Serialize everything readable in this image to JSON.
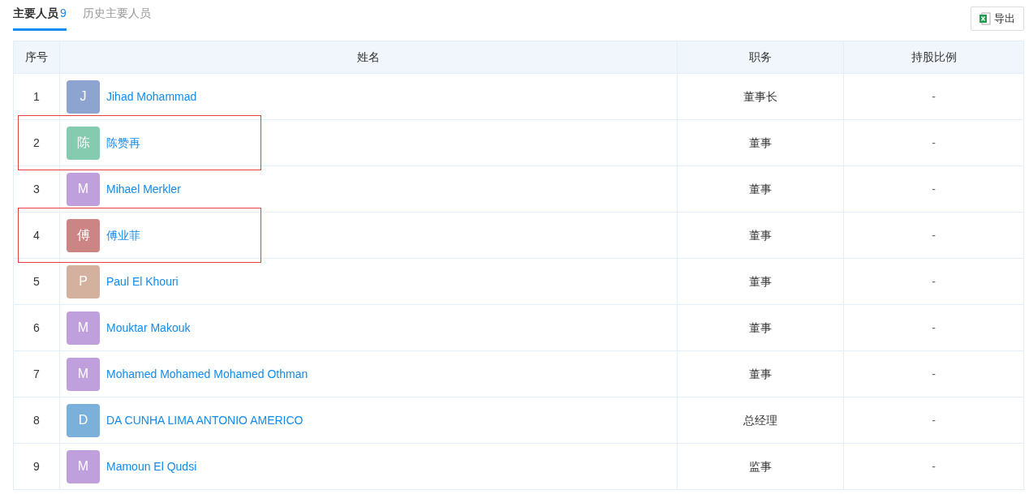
{
  "tabs": [
    {
      "label": "主要人员",
      "count": "9",
      "selected": true
    },
    {
      "label": "历史主要人员",
      "selected": false
    }
  ],
  "export_button": {
    "label": "导出"
  },
  "table": {
    "columns": [
      "序号",
      "姓名",
      "职务",
      "持股比例"
    ],
    "rows": [
      {
        "index": "1",
        "avatar": "J",
        "color": "#8da4d0",
        "name": "Jihad Mohammad",
        "position": "董事长",
        "share": "-",
        "highlighted": false
      },
      {
        "index": "2",
        "avatar": "陈",
        "color": "#85cbaf",
        "name": "陈赞再",
        "position": "董事",
        "share": "-",
        "highlighted": true
      },
      {
        "index": "3",
        "avatar": "M",
        "color": "#bfa0dc",
        "name": "Mihael Merkler",
        "position": "董事",
        "share": "-",
        "highlighted": false
      },
      {
        "index": "4",
        "avatar": "傅",
        "color": "#cc8484",
        "name": "傅业菲",
        "position": "董事",
        "share": "-",
        "highlighted": true
      },
      {
        "index": "5",
        "avatar": "P",
        "color": "#d4b09e",
        "name": "Paul El Khouri",
        "position": "董事",
        "share": "-",
        "highlighted": false
      },
      {
        "index": "6",
        "avatar": "M",
        "color": "#bfa0dc",
        "name": "Mouktar Makouk",
        "position": "董事",
        "share": "-",
        "highlighted": false
      },
      {
        "index": "7",
        "avatar": "M",
        "color": "#bfa0dc",
        "name": "Mohamed Mohamed Mohamed Othman",
        "position": "董事",
        "share": "-",
        "highlighted": false
      },
      {
        "index": "8",
        "avatar": "D",
        "color": "#7ab0d9",
        "name": "DA CUNHA LIMA ANTONIO AMERICO",
        "position": "总经理",
        "share": "-",
        "highlighted": false
      },
      {
        "index": "9",
        "avatar": "M",
        "color": "#bfa0dc",
        "name": "Mamoun El Qudsi",
        "position": "监事",
        "share": "-",
        "highlighted": false
      }
    ]
  }
}
